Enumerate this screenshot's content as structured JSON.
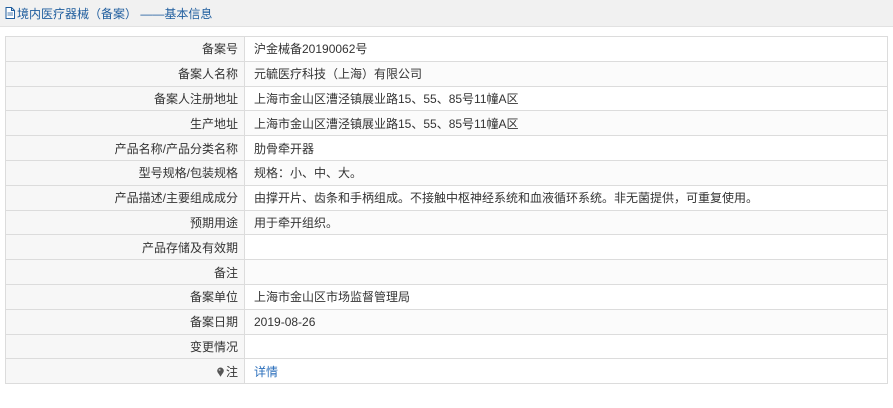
{
  "header": {
    "title": "境内医疗器械（备案） ——基本信息",
    "icon": "document-icon"
  },
  "rows": [
    {
      "label": "备案号",
      "value": "沪金械备20190062号"
    },
    {
      "label": "备案人名称",
      "value": "元毓医疗科技（上海）有限公司"
    },
    {
      "label": "备案人注册地址",
      "value": "上海市金山区漕泾镇展业路15、55、85号11幢A区"
    },
    {
      "label": "生产地址",
      "value": "上海市金山区漕泾镇展业路15、55、85号11幢A区"
    },
    {
      "label": "产品名称/产品分类名称",
      "value": "肋骨牵开器"
    },
    {
      "label": "型号规格/包装规格",
      "value": "规格：小、中、大。"
    },
    {
      "label": "产品描述/主要组成成分",
      "value": "由撑开片、齿条和手柄组成。不接触中枢神经系统和血液循环系统。非无菌提供，可重复使用。"
    },
    {
      "label": "预期用途",
      "value": "用于牵开组织。"
    },
    {
      "label": "产品存储及有效期",
      "value": ""
    },
    {
      "label": "备注",
      "value": ""
    },
    {
      "label": "备案单位",
      "value": "上海市金山区市场监督管理局"
    },
    {
      "label": "备案日期",
      "value": "2019-08-26"
    },
    {
      "label": "变更情况",
      "value": ""
    }
  ],
  "note_row": {
    "label": "注",
    "icon": "pin-icon",
    "link": "详情"
  }
}
